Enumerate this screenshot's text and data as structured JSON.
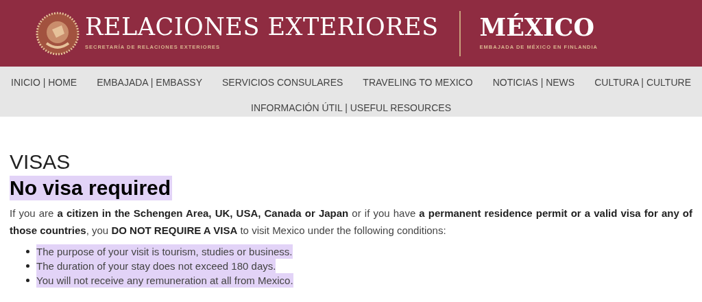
{
  "header": {
    "title": "RELACIONES EXTERIORES",
    "subtitle": "SECRETARÍA DE RELACIONES EXTERIORES",
    "country": "MÉXICO",
    "embassy": "EMBAJADA DE MÉXICO EN FINLANDIA"
  },
  "nav": [
    {
      "label": "INICIO | HOME"
    },
    {
      "label": "EMBAJADA | EMBASSY"
    },
    {
      "label": "SERVICIOS CONSULARES"
    },
    {
      "label": "TRAVELING TO MEXICO"
    },
    {
      "label": "NOTICIAS | NEWS"
    },
    {
      "label": "CULTURA | CULTURE"
    },
    {
      "label": "INFORMACIÓN ÚTIL | USEFUL RESOURCES"
    }
  ],
  "page_title": "VISAS",
  "heading": {
    "text": "No visa required",
    "highlighted": true
  },
  "intro": "If you are **a citizen in the Schengen Area, UK, USA, Canada or Japan** or if you have **a permanent residence permit or a valid visa for any of those countries**, you **DO NOT REQUIRE A VISA** to visit Mexico under the following conditions:",
  "conditions": [
    {
      "text": "The purpose of your visit is tourism, studies or business.",
      "highlighted": true
    },
    {
      "text": "The duration of your stay does not exceed 180 days.",
      "highlighted": true
    },
    {
      "text": "You will not receive any remuneration at all from Mexico.",
      "highlighted": true
    }
  ]
}
